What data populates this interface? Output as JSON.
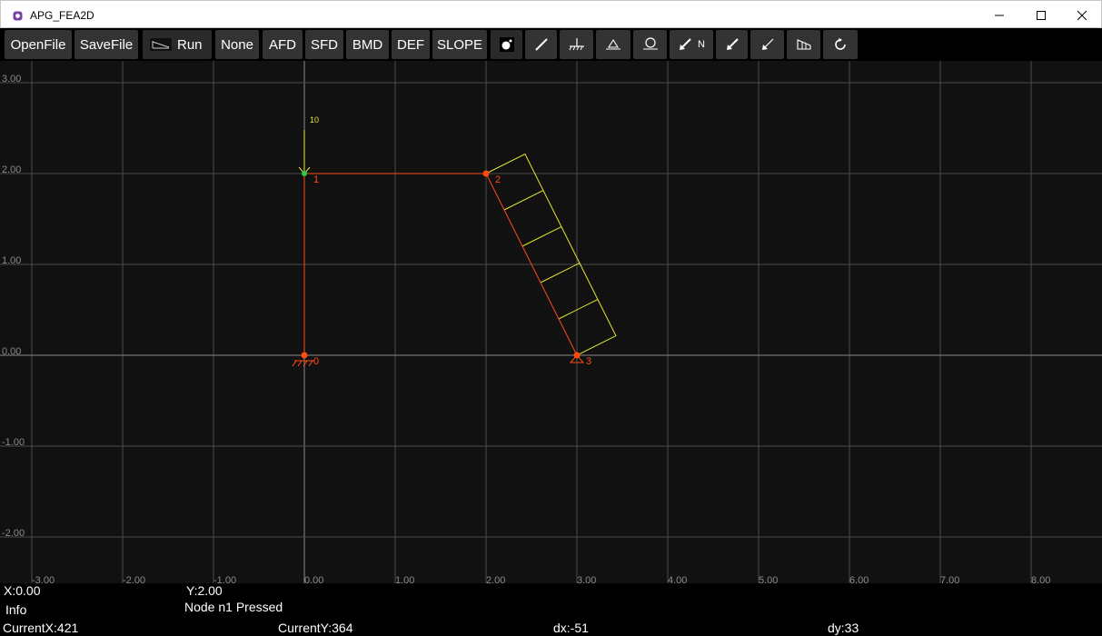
{
  "window": {
    "title": "APG_FEA2D",
    "controls": {
      "minimize": "—",
      "maximize": "☐",
      "close": "✕"
    }
  },
  "toolbar": {
    "open_label": "OpenFile",
    "save_label": "SaveFile",
    "run_label": "Run",
    "views": [
      "None",
      "AFD",
      "SFD",
      "BMD",
      "DEF",
      "SLOPE"
    ],
    "node_tag": "N"
  },
  "canvas": {
    "y_ticks": [
      "3.00",
      "2.00",
      "1.00",
      "0.00",
      "-1.00",
      "-2.00"
    ],
    "x_ticks": [
      "-3.00",
      "-2.00",
      "-1.00",
      "0.00",
      "1.00",
      "2.00",
      "3.00",
      "4.00",
      "5.00",
      "6.00",
      "7.00",
      "8.00"
    ],
    "nodes": [
      {
        "id": "0",
        "x": 0,
        "y": 0,
        "support": "fixed"
      },
      {
        "id": "1",
        "x": 0,
        "y": 2,
        "support": "none"
      },
      {
        "id": "2",
        "x": 2,
        "y": 2,
        "support": "none"
      },
      {
        "id": "3",
        "x": 3,
        "y": 0,
        "support": "pin"
      }
    ],
    "elements": [
      [
        "0",
        "1"
      ],
      [
        "1",
        "2"
      ],
      [
        "2",
        "3"
      ]
    ],
    "point_load": {
      "node": "1",
      "value": "10"
    },
    "colors": {
      "member": "#ff4a12",
      "load": "#e8e830",
      "grid": "#4a4a4a",
      "axis": "#8a8a8a",
      "tick_text": "#8a8a8a"
    }
  },
  "status": {
    "x": "X:0.00",
    "y": "Y:2.00",
    "info": "Info",
    "message": "Node n1 Pressed",
    "current_x": "CurrentX:421",
    "current_y": "CurrentY:364",
    "dx": "dx:-51",
    "dy": "dy:33"
  }
}
